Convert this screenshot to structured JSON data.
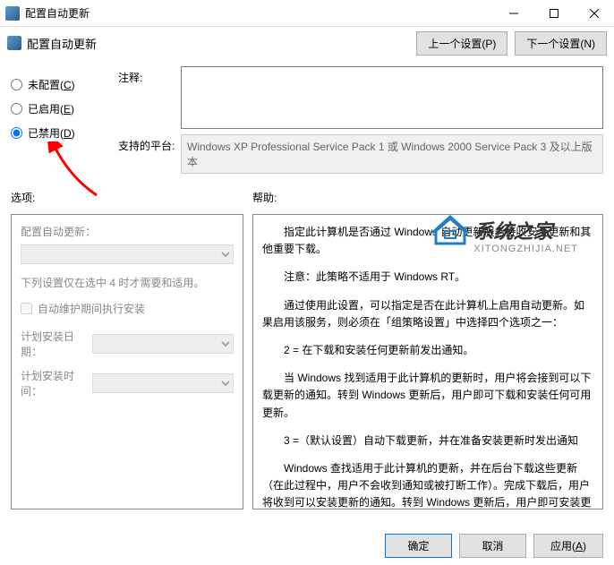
{
  "window": {
    "title": "配置自动更新"
  },
  "toolbar": {
    "title": "配置自动更新",
    "prev": "上一个设置(P)",
    "next": "下一个设置(N)"
  },
  "radios": {
    "not_configured": "未配置(C)",
    "enabled": "已启用(E)",
    "disabled": "已禁用(D)"
  },
  "fields": {
    "comment_label": "注释:",
    "platform_label": "支持的平台:",
    "platform_text": "Windows XP Professional Service Pack 1 或 Windows 2000 Service Pack 3 及以上版本"
  },
  "sections": {
    "options_label": "选项:",
    "help_label": "帮助:"
  },
  "options": {
    "config_label": "配置自动更新：",
    "note": "下列设置仅在选中 4 时才需要和适用。",
    "checkbox": "自动维护期间执行安装",
    "install_day": "计划安装日期：",
    "install_time": "计划安装时间："
  },
  "help": {
    "p1": "指定此计算机是否通过 Windows 自动更新服务接收安全更新和其他重要下载。",
    "p2": "注意：此策略不适用于 Windows RT。",
    "p3": "通过使用此设置，可以指定是否在此计算机上启用自动更新。如果启用该服务，则必须在「组策略设置」中选择四个选项之一：",
    "p4": "2 = 在下载和安装任何更新前发出通知。",
    "p5": "当 Windows 找到适用于此计算机的更新时，用户将会接到可以下载更新的通知。转到 Windows 更新后，用户即可下载和安装任何可用更新。",
    "p6": "3 =（默认设置）自动下载更新，并在准备安装更新时发出通知",
    "p7": "Windows 查找适用于此计算机的更新，并在后台下载这些更新（在此过程中，用户不会收到通知或被打断工作）。完成下载后，用户将收到可以安装更新的通知。转到 Windows 更新后，用户即可安装更新。"
  },
  "buttons": {
    "ok": "确定",
    "cancel": "取消",
    "apply": "应用(A)"
  },
  "watermark": {
    "text": "系统之家",
    "url": "XITONGZHIJIA.NET"
  }
}
